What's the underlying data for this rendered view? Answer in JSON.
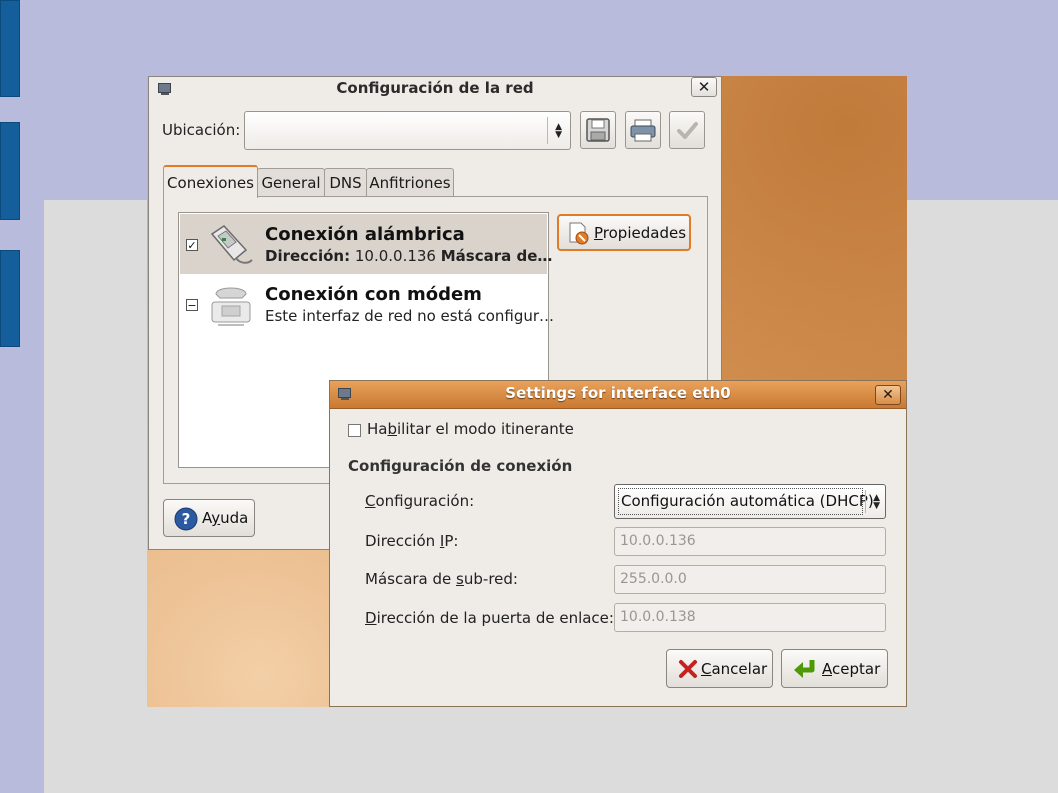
{
  "main_window": {
    "title": "Configuración de la red",
    "location_label": "Ubicación:",
    "location_value": "",
    "tabs": [
      {
        "label": "Conexiones"
      },
      {
        "label": "General"
      },
      {
        "label": "DNS"
      },
      {
        "label": "Anfitriones"
      }
    ],
    "connections": [
      {
        "title": "Conexión alámbrica",
        "detail_label": "Dirección:",
        "detail_value": "10.0.0.136",
        "detail_extra": "Máscara de…",
        "checked": true,
        "icon": "ethernet-icon"
      },
      {
        "title": "Conexión con módem",
        "detail": "Este interfaz de red no está configur…",
        "checked": "indeterminate",
        "icon": "modem-phone-icon"
      }
    ],
    "properties_button": {
      "pre": "",
      "accel": "P",
      "rest": "ropiedades"
    },
    "help_button": {
      "pre": "A",
      "accel": "y",
      "rest": "uda"
    }
  },
  "dialog": {
    "title": "Settings for interface eth0",
    "roaming": {
      "pre": "Ha",
      "accel": "b",
      "rest": "ilitar el modo itinerante",
      "checked": false
    },
    "section_title": "Configuración de conexión",
    "config_label": {
      "pre": "",
      "accel": "C",
      "rest": "onfiguración:"
    },
    "config_value": "Configuración automática (DHCP)",
    "ip_label": {
      "pre": "Dirección ",
      "accel": "I",
      "rest": "P:"
    },
    "ip_value": "10.0.0.136",
    "mask_label": {
      "pre": "Máscara de ",
      "accel": "s",
      "rest": "ub-red:"
    },
    "mask_value": "255.0.0.0",
    "gateway_label": {
      "pre": "",
      "accel": "D",
      "rest": "irección de la puerta de enlace:"
    },
    "gateway_value": "10.0.0.138",
    "cancel": {
      "pre": "",
      "accel": "C",
      "rest": "ancelar"
    },
    "accept": {
      "pre": "",
      "accel": "A",
      "rest": "ceptar"
    }
  },
  "colors": {
    "accent": "#e07b27",
    "slide_sidebar": "#145f9b",
    "titlebar_active": "#d98d45"
  }
}
